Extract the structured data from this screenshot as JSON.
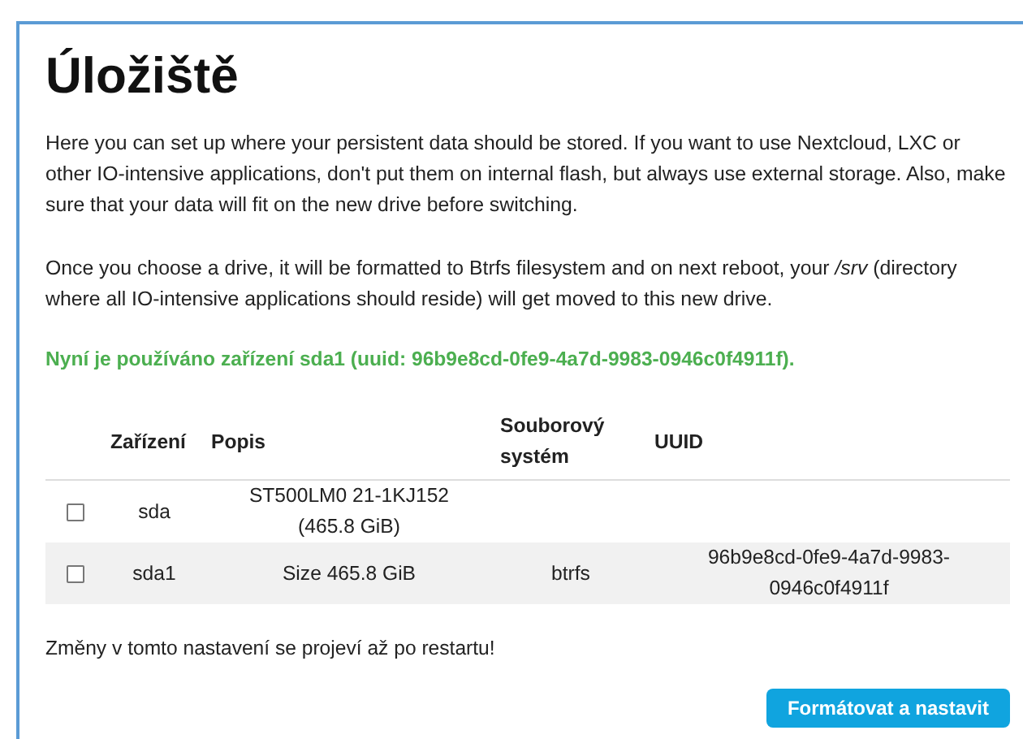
{
  "title": "Úložiště",
  "paragraphs": [
    "Here you can set up where your persistent data should be stored. If you want to use Nextcloud, LXC or other IO-intensive applications, don't put them on internal flash, but always use external storage. Also, make sure that your data will fit on the new drive before switching.",
    "Once you choose a drive, it will be formatted to Btrfs filesystem and on next reboot, your */srv* (directory where all IO-intensive applications should reside) will get moved to this new drive."
  ],
  "status": "Nyní je používáno zařízení sda1 (uuid: 96b9e8cd-0fe9-4a7d-9983-0946c0f4911f).",
  "table": {
    "columns": [
      "Zařízení",
      "Popis",
      "Souborový systém",
      "UUID"
    ],
    "rows": [
      {
        "checked": false,
        "cells": [
          "sda",
          "ST500LM0 21-1KJ152 (465.8 GiB)",
          "",
          ""
        ]
      },
      {
        "checked": false,
        "cells": [
          "sda1",
          "Size 465.8 GiB",
          "btrfs",
          "96b9e8cd-0fe9-4a7d-9983-0946c0f4911f"
        ]
      }
    ]
  },
  "note": "Změny v tomto nastavení se projeví až po restartu!",
  "button": "Formátovat a nastavit"
}
